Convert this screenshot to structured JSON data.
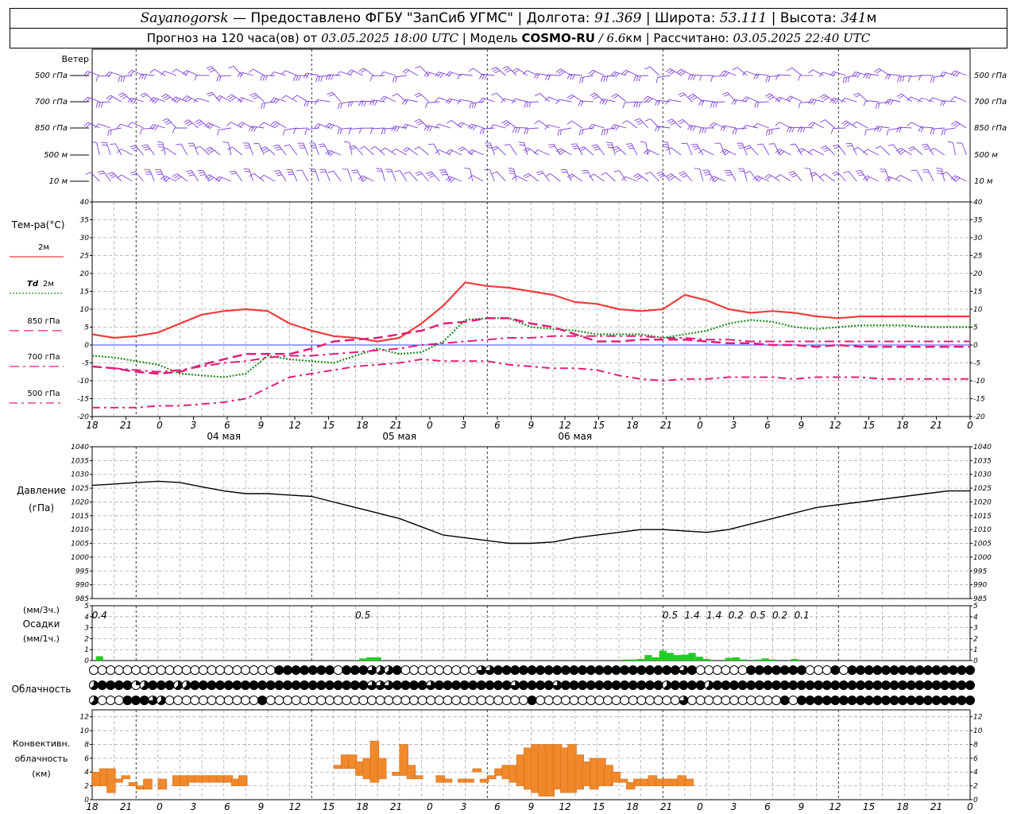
{
  "header": {
    "station": "Sayanogorsk",
    "provided": " — Предоставлено ФГБУ \"ЗапСиб УГМС\" | Долгота: ",
    "lon": "91.369",
    "lat_label": " | Широта: ",
    "lat": "53.111",
    "alt_label": " | Высота: ",
    "alt": "341",
    "alt_unit": "м",
    "forecast_prefix": "Прогноз на 120 часа(ов) от ",
    "forecast_start": "03.05.2025 18:00 UTC",
    "model_label": " | Модель ",
    "model": "COSMO-RU",
    "model_res": " / 6.6",
    "model_res_unit": "км",
    "calc_label": " | Рассчитано: ",
    "calc_time": "03.05.2025 22:40 UTC"
  },
  "labels": {
    "wind": "Ветер",
    "wind_levels": [
      "500 гПа",
      "700 гПа",
      "850 гПа",
      "500 м",
      "10 м"
    ],
    "temp_title": "Тем-ра(°C)",
    "t2m": "2м",
    "td": "Td",
    "td2m": "2м",
    "t850": "850 гПа",
    "t700": "700 гПа",
    "t500": "500 гПа",
    "pressure": "Давление",
    "pressure_unit": "(гПа)",
    "precip_unit3": "(мм/3ч.)",
    "precip": "Осадки",
    "precip_unit1": "(мм/1ч.)",
    "cloud": "Облачность",
    "conv1": "Конвективн.",
    "conv2": "облачность",
    "conv_unit": "(км)"
  },
  "colors": {
    "t2m": "#f03c3c",
    "td": "#1e8c1e",
    "t850": "#e0207a",
    "t700": "#e0207a",
    "t500": "#e0207a",
    "wind": "#8040d8",
    "pressure": "#000000",
    "precip": "#22cc22",
    "conv": "#f0882c",
    "zero": "#3040ff"
  },
  "chart_data": [
    {
      "type": "line",
      "x_ticks": [
        "18",
        "21",
        "0",
        "3",
        "6",
        "9",
        "12",
        "15",
        "18",
        "21",
        "0",
        "3",
        "6",
        "9",
        "12",
        "15",
        "18",
        "21",
        "0",
        "3",
        "6",
        "9",
        "12",
        "15",
        "18",
        "21",
        "0"
      ],
      "day_labels": [
        "04 мая",
        "05 мая",
        "06 мая"
      ],
      "ylim": [
        -20,
        40
      ],
      "y_ticks": [
        -20,
        -15,
        -10,
        -5,
        0,
        5,
        10,
        15,
        20,
        25,
        30,
        35,
        40
      ],
      "x_hours": [
        0,
        3,
        6,
        9,
        12,
        15,
        18,
        21,
        24,
        27,
        30,
        33,
        36,
        39,
        42,
        45,
        48,
        51,
        54,
        57,
        60,
        63,
        66,
        69,
        72,
        75,
        78,
        81,
        84,
        87,
        90,
        93,
        96,
        99,
        102,
        105,
        108,
        111,
        114,
        117,
        120
      ],
      "series": [
        {
          "key": "t2m",
          "values": [
            3,
            2,
            2.5,
            3.5,
            6,
            8.5,
            9.5,
            10,
            9.5,
            6,
            4,
            2.5,
            2,
            1,
            2,
            6,
            11,
            17.5,
            16.5,
            16,
            15,
            14,
            12,
            11.5,
            10,
            9.5,
            10,
            14,
            12.5,
            10,
            9,
            9.5,
            9,
            8,
            7.5,
            8,
            8,
            8,
            8,
            8,
            8
          ]
        },
        {
          "key": "td",
          "values": [
            -3,
            -3.5,
            -4.5,
            -5.5,
            -8,
            -8.5,
            -9,
            -8,
            -3,
            -4,
            -4.5,
            -5,
            -3,
            -1,
            -2.5,
            -2,
            1,
            7,
            7.5,
            7.5,
            5,
            4.5,
            4,
            3,
            3,
            3,
            2,
            3,
            4,
            6,
            7,
            6.5,
            5,
            4.5,
            5,
            5.5,
            5.5,
            5.5,
            5,
            5,
            5
          ]
        },
        {
          "key": "t850",
          "values": [
            -6,
            -6.5,
            -7.5,
            -8,
            -7.5,
            -5.5,
            -4,
            -2.5,
            -2.5,
            -2.5,
            -1,
            1,
            1.5,
            2,
            3,
            4,
            6,
            6.5,
            7.5,
            7.5,
            6,
            5,
            3,
            1,
            1,
            1.5,
            1.5,
            1.5,
            1,
            0.5,
            0.5,
            0,
            0,
            -0.5,
            0,
            -0.5,
            -0.5,
            -0.5,
            -0.5,
            -0.5,
            -0.5
          ]
        },
        {
          "key": "t700",
          "values": [
            -6,
            -6.5,
            -7,
            -7.5,
            -7,
            -6,
            -5,
            -4.5,
            -3.5,
            -3,
            -3,
            -2.5,
            -2,
            -1.5,
            -1,
            0,
            0.5,
            1,
            1.5,
            2,
            2,
            2.5,
            2.5,
            2.5,
            2.5,
            2.5,
            2,
            2,
            1.5,
            1.5,
            1,
            1,
            1,
            1,
            1,
            1,
            1,
            1,
            1,
            1,
            1
          ]
        },
        {
          "key": "t500",
          "values": [
            -17.5,
            -17.5,
            -17.5,
            -17,
            -17,
            -16.5,
            -16,
            -15,
            -12,
            -9,
            -8,
            -7,
            -6,
            -5.5,
            -5,
            -4,
            -4.5,
            -4.5,
            -4.5,
            -5.5,
            -6,
            -6.5,
            -6.5,
            -7,
            -8.5,
            -9.5,
            -10,
            -9.5,
            -9.5,
            -9,
            -9,
            -9,
            -9.5,
            -9,
            -9,
            -9,
            -9.5,
            -9.5,
            -9.5,
            -9.5,
            -9.5
          ]
        }
      ]
    },
    {
      "type": "line",
      "series_name": "pressure",
      "ylim": [
        985,
        1040
      ],
      "y_ticks": [
        985,
        990,
        995,
        1000,
        1005,
        1010,
        1015,
        1020,
        1025,
        1030,
        1035,
        1040
      ],
      "x_hours": [
        0,
        3,
        6,
        9,
        12,
        15,
        18,
        21,
        24,
        27,
        30,
        33,
        36,
        39,
        42,
        45,
        48,
        51,
        54,
        57,
        60,
        63,
        66,
        69,
        72,
        75,
        78,
        81,
        84,
        87,
        90,
        93,
        96,
        99,
        102,
        105,
        108,
        111,
        114,
        117,
        120
      ],
      "values": [
        1026,
        1026.5,
        1027,
        1027.5,
        1027,
        1025.5,
        1024,
        1023,
        1023,
        1022.5,
        1022,
        1020,
        1018,
        1016,
        1014,
        1011,
        1008,
        1007,
        1006,
        1005,
        1005,
        1005.5,
        1007,
        1008,
        1009,
        1010,
        1010,
        1009.5,
        1009,
        1010,
        1012,
        1014,
        1016,
        1018,
        1019,
        1020,
        1021,
        1022,
        1023,
        1024,
        1024
      ]
    },
    {
      "type": "bar",
      "series_name": "precip",
      "ylim": [
        0,
        5
      ],
      "y_ticks": [
        0,
        1,
        2,
        3,
        4,
        5
      ],
      "labels_3h": [
        {
          "hour": 1,
          "text": "0.4"
        },
        {
          "hour": 37,
          "text": "0.5"
        },
        {
          "hour": 79,
          "text": "0.5"
        },
        {
          "hour": 82,
          "text": "1.4"
        },
        {
          "hour": 85,
          "text": "1.4"
        },
        {
          "hour": 88,
          "text": "0.2"
        },
        {
          "hour": 91,
          "text": "0.5"
        },
        {
          "hour": 94,
          "text": "0.2"
        },
        {
          "hour": 97,
          "text": "0.1"
        }
      ],
      "hourly": [
        {
          "h": 1,
          "v": 0.4
        },
        {
          "h": 37,
          "v": 0.2
        },
        {
          "h": 38,
          "v": 0.3
        },
        {
          "h": 39,
          "v": 0.3
        },
        {
          "h": 73,
          "v": 0.1
        },
        {
          "h": 74,
          "v": 0.1
        },
        {
          "h": 75,
          "v": 0.15
        },
        {
          "h": 76,
          "v": 0.5
        },
        {
          "h": 77,
          "v": 0.3
        },
        {
          "h": 78,
          "v": 0.9
        },
        {
          "h": 79,
          "v": 0.7
        },
        {
          "h": 80,
          "v": 0.5
        },
        {
          "h": 81,
          "v": 0.55
        },
        {
          "h": 82,
          "v": 0.7
        },
        {
          "h": 83,
          "v": 0.35
        },
        {
          "h": 84,
          "v": 0.15
        },
        {
          "h": 87,
          "v": 0.25
        },
        {
          "h": 88,
          "v": 0.3
        },
        {
          "h": 89,
          "v": 0.1
        },
        {
          "h": 91,
          "v": 0.1
        },
        {
          "h": 92,
          "v": 0.2
        },
        {
          "h": 93,
          "v": 0.1
        },
        {
          "h": 96,
          "v": 0.15
        }
      ]
    },
    {
      "type": "table",
      "series_name": "cloudiness",
      "rows": [
        "000000000000000000000088888880888655800000000066888888888888888888888868000000888888800080888888888888888",
        "588882588855888888888888888888888666888868888888886888868888888888885888858888888888888888888888888888888",
        "500088865000000000008000000000000000000000000000000080000000000000000060000000000080888888888888888888888"
      ]
    },
    {
      "type": "bar",
      "series_name": "convective",
      "ylim": [
        0,
        13
      ],
      "y_ticks": [
        0,
        2,
        4,
        6,
        8,
        10,
        12
      ],
      "segments": [
        {
          "h": 0,
          "lo": 2,
          "hi": 4
        },
        {
          "h": 1,
          "lo": 2,
          "hi": 4.5
        },
        {
          "h": 2,
          "lo": 1,
          "hi": 4.5
        },
        {
          "h": 3,
          "lo": 2.5,
          "hi": 3
        },
        {
          "h": 4,
          "lo": 3,
          "hi": 3.5
        },
        {
          "h": 5,
          "lo": 2,
          "hi": 2.5
        },
        {
          "h": 6,
          "lo": 1.5,
          "hi": 2
        },
        {
          "h": 7,
          "lo": 1.5,
          "hi": 3
        },
        {
          "h": 9,
          "lo": 1.5,
          "hi": 3
        },
        {
          "h": 11,
          "lo": 2,
          "hi": 3.5
        },
        {
          "h": 12,
          "lo": 2,
          "hi": 3.5
        },
        {
          "h": 13,
          "lo": 2.5,
          "hi": 3.5
        },
        {
          "h": 14,
          "lo": 2.5,
          "hi": 3.5
        },
        {
          "h": 15,
          "lo": 2.5,
          "hi": 3.5
        },
        {
          "h": 16,
          "lo": 2.5,
          "hi": 3.5
        },
        {
          "h": 17,
          "lo": 2.5,
          "hi": 3.5
        },
        {
          "h": 18,
          "lo": 2.5,
          "hi": 3.5
        },
        {
          "h": 19,
          "lo": 2,
          "hi": 3
        },
        {
          "h": 20,
          "lo": 2,
          "hi": 3.5
        },
        {
          "h": 33,
          "lo": 4.5,
          "hi": 5
        },
        {
          "h": 34,
          "lo": 4.5,
          "hi": 6.5
        },
        {
          "h": 35,
          "lo": 4.5,
          "hi": 6.5
        },
        {
          "h": 36,
          "lo": 3.5,
          "hi": 5.5
        },
        {
          "h": 37,
          "lo": 3,
          "hi": 6
        },
        {
          "h": 38,
          "lo": 2.5,
          "hi": 8.5
        },
        {
          "h": 39,
          "lo": 3,
          "hi": 6
        },
        {
          "h": 41,
          "lo": 3.5,
          "hi": 4
        },
        {
          "h": 42,
          "lo": 3.5,
          "hi": 8
        },
        {
          "h": 43,
          "lo": 3,
          "hi": 5
        },
        {
          "h": 44,
          "lo": 3,
          "hi": 3.5
        },
        {
          "h": 47,
          "lo": 2.5,
          "hi": 3.5
        },
        {
          "h": 48,
          "lo": 2.5,
          "hi": 3
        },
        {
          "h": 50,
          "lo": 2.5,
          "hi": 3
        },
        {
          "h": 51,
          "lo": 2.5,
          "hi": 3
        },
        {
          "h": 52,
          "lo": 4,
          "hi": 4.5
        },
        {
          "h": 53,
          "lo": 2.5,
          "hi": 3
        },
        {
          "h": 54,
          "lo": 3,
          "hi": 3.5
        },
        {
          "h": 55,
          "lo": 3.5,
          "hi": 4.5
        },
        {
          "h": 56,
          "lo": 3,
          "hi": 5
        },
        {
          "h": 57,
          "lo": 2.5,
          "hi": 5
        },
        {
          "h": 58,
          "lo": 2,
          "hi": 6.5
        },
        {
          "h": 59,
          "lo": 1.5,
          "hi": 7.5
        },
        {
          "h": 60,
          "lo": 1,
          "hi": 8
        },
        {
          "h": 61,
          "lo": 0.5,
          "hi": 8
        },
        {
          "h": 62,
          "lo": 0.5,
          "hi": 8
        },
        {
          "h": 63,
          "lo": 1.5,
          "hi": 8
        },
        {
          "h": 64,
          "lo": 1,
          "hi": 7.5
        },
        {
          "h": 65,
          "lo": 1,
          "hi": 8
        },
        {
          "h": 66,
          "lo": 1.5,
          "hi": 6.5
        },
        {
          "h": 67,
          "lo": 2,
          "hi": 5.5
        },
        {
          "h": 68,
          "lo": 1.5,
          "hi": 6
        },
        {
          "h": 69,
          "lo": 2,
          "hi": 6
        },
        {
          "h": 70,
          "lo": 2,
          "hi": 5
        },
        {
          "h": 71,
          "lo": 2.5,
          "hi": 4
        },
        {
          "h": 72,
          "lo": 2.5,
          "hi": 3
        },
        {
          "h": 73,
          "lo": 1.5,
          "hi": 2.5
        },
        {
          "h": 74,
          "lo": 2,
          "hi": 3
        },
        {
          "h": 75,
          "lo": 2,
          "hi": 3
        },
        {
          "h": 76,
          "lo": 2,
          "hi": 3.5
        },
        {
          "h": 77,
          "lo": 2,
          "hi": 3
        },
        {
          "h": 78,
          "lo": 2,
          "hi": 3
        },
        {
          "h": 79,
          "lo": 2,
          "hi": 3
        },
        {
          "h": 80,
          "lo": 2,
          "hi": 3.5
        },
        {
          "h": 81,
          "lo": 2,
          "hi": 3
        }
      ]
    }
  ]
}
